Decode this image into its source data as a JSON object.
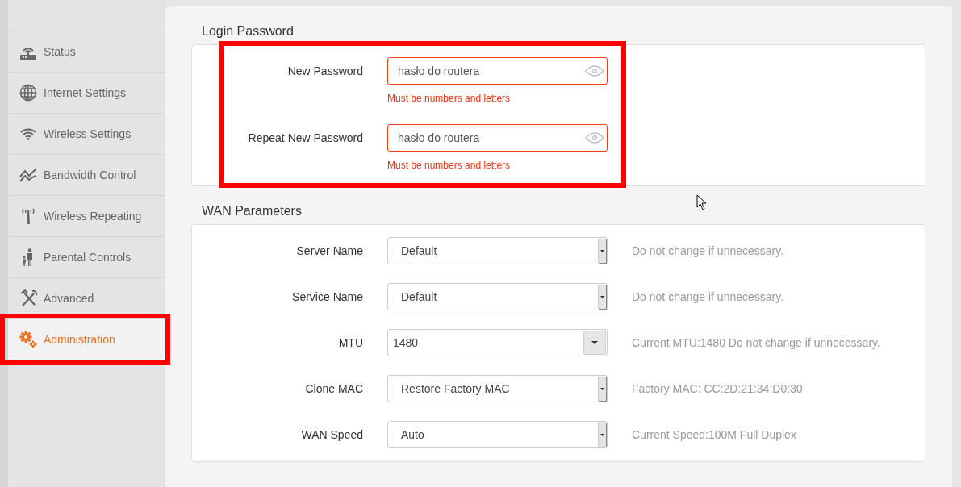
{
  "sidebar": {
    "items": [
      {
        "label": "Status",
        "selected": false,
        "highlighted": false
      },
      {
        "label": "Internet Settings",
        "selected": false,
        "highlighted": false
      },
      {
        "label": "Wireless Settings",
        "selected": false,
        "highlighted": false
      },
      {
        "label": "Bandwidth Control",
        "selected": false,
        "highlighted": false
      },
      {
        "label": "Wireless Repeating",
        "selected": false,
        "highlighted": false
      },
      {
        "label": "Parental Controls",
        "selected": false,
        "highlighted": false
      },
      {
        "label": "Advanced",
        "selected": false,
        "highlighted": false
      },
      {
        "label": "Administration",
        "selected": true,
        "highlighted": true
      }
    ]
  },
  "login_password": {
    "title": "Login Password",
    "highlighted": true,
    "fields": [
      {
        "label": "New Password",
        "value": "hasło do routera",
        "error": "Must be numbers and letters"
      },
      {
        "label": "Repeat New Password",
        "value": "hasło do routera",
        "error": "Must be numbers and letters"
      }
    ]
  },
  "wan_parameters": {
    "title": "WAN Parameters",
    "rows": [
      {
        "label": "Server Name",
        "kind": "select",
        "value": "Default",
        "hint": "Do not change if unnecessary."
      },
      {
        "label": "Service Name",
        "kind": "select",
        "value": "Default",
        "hint": "Do not change if unnecessary."
      },
      {
        "label": "MTU",
        "kind": "combo",
        "value": "1480",
        "hint": "Current MTU:1480 Do not change if unnecessary."
      },
      {
        "label": "Clone MAC",
        "kind": "select",
        "value": "Restore Factory MAC",
        "hint": "Factory MAC: CC:2D:21:34:D0:30"
      },
      {
        "label": "WAN Speed",
        "kind": "select",
        "value": "Auto",
        "hint": "Current Speed:100M Full Duplex"
      }
    ]
  }
}
